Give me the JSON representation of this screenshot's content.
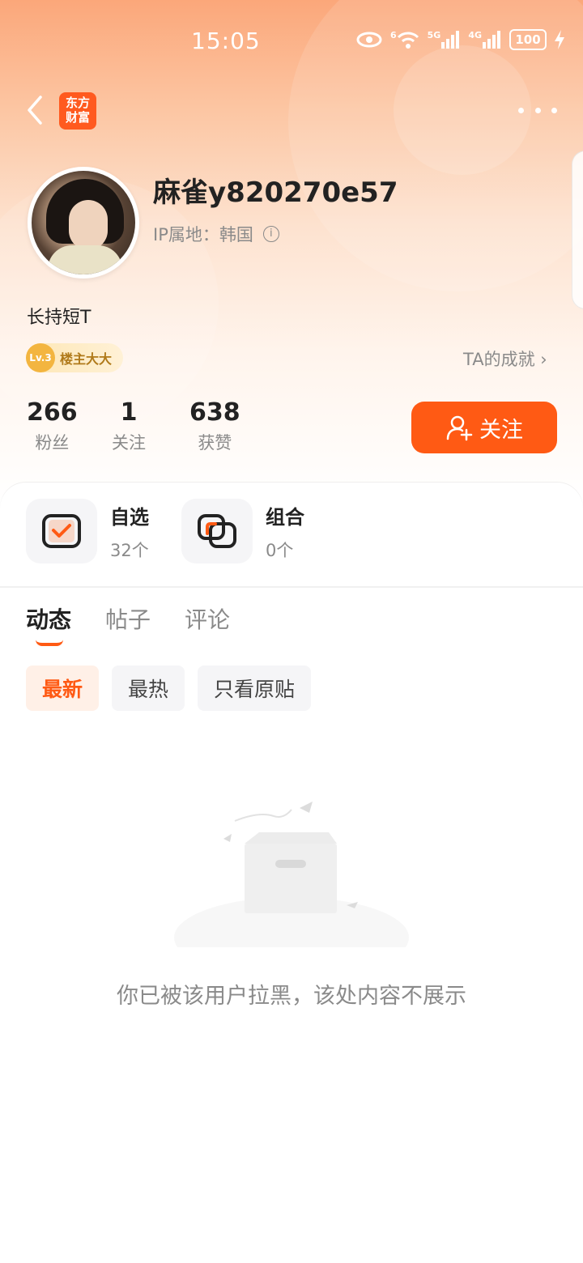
{
  "status_bar": {
    "time": "15:05",
    "signal_6": "6",
    "signal_5g": "5G",
    "signal_4g": "4G",
    "battery": "100",
    "icons": [
      "eye-icon",
      "wifi-icon",
      "signal-5g-icon",
      "signal-4g-icon",
      "battery-icon",
      "charging-icon"
    ]
  },
  "header": {
    "logo_line1": "东方",
    "logo_line2": "财富"
  },
  "profile": {
    "username": "麻雀y820270e57",
    "ip_location": "IP属地：韩国",
    "bio": "长持短T",
    "badge_label": "楼主大大",
    "badge_level": "Lv.3",
    "achievements_label": "TA的成就",
    "achievements_arrow": "›"
  },
  "stats": [
    {
      "value": "266",
      "label": "粉丝"
    },
    {
      "value": "1",
      "label": "关注"
    },
    {
      "value": "638",
      "label": "获赞"
    }
  ],
  "follow_button": {
    "label": "关注"
  },
  "quick_links": [
    {
      "title": "自选",
      "count": "32个",
      "icon": "watchlist-icon"
    },
    {
      "title": "组合",
      "count": "0个",
      "icon": "portfolio-icon"
    }
  ],
  "tabs": [
    {
      "label": "动态",
      "active": true
    },
    {
      "label": "帖子",
      "active": false
    },
    {
      "label": "评论",
      "active": false
    }
  ],
  "filters": [
    {
      "label": "最新",
      "active": true
    },
    {
      "label": "最热",
      "active": false
    },
    {
      "label": "只看原贴",
      "active": false
    }
  ],
  "empty_state": {
    "message": "你已被该用户拉黑，该处内容不展示"
  },
  "colors": {
    "accent": "#ff5a14",
    "hero_top": "#fba77a",
    "muted_text": "#8a8a8a"
  }
}
